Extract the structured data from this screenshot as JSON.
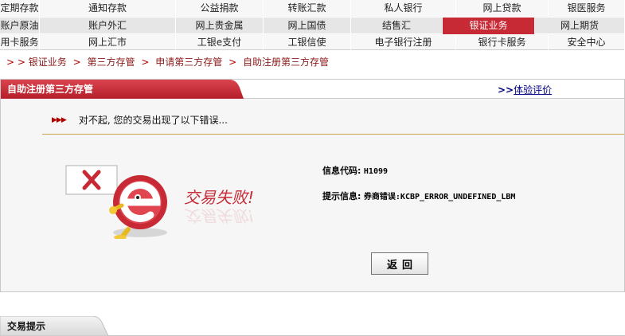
{
  "nav": {
    "rows": [
      [
        "定期存款",
        "通知存款",
        "公益捐款",
        "转账汇款",
        "私人银行",
        "网上贷款",
        "银医服务"
      ],
      [
        "账户原油",
        "账户外汇",
        "网上贵金属",
        "网上国债",
        "结售汇",
        "银证业务",
        "网上期货"
      ],
      [
        "用卡服务",
        "网上汇市",
        "工银e支付",
        "工银信使",
        "电子银行注册",
        "银行卡服务",
        "安全中心"
      ]
    ],
    "active_label": "银证业务"
  },
  "breadcrumb": {
    "prefix": "> >",
    "items": [
      "银证业务",
      "第三方存管",
      "申请第三方存管",
      "自助注册第三方存管"
    ],
    "separator": ">"
  },
  "panel": {
    "title": "自助注册第三方存管",
    "feedback_arrow": ">>",
    "feedback_link": "体验评价",
    "message_marker": "▶▶▶",
    "message": "对不起, 您的交易出现了以下错误...",
    "fail_text": "交易失败!",
    "info_code_label": "信息代码:",
    "info_code_value": "H1099",
    "info_tip_label": "提示信息:",
    "info_tip_value": "券商错误:KCBP_ERROR_UNDEFINED_LBM",
    "back_button": "返回"
  },
  "bottom": {
    "title": "交易提示"
  },
  "colors": {
    "brand_red": "#c72a35",
    "link_blue": "#000080",
    "divider_gold": "#c9a24a"
  },
  "icons": {
    "error": "red-x-card-icon",
    "mascot": "e-mascot-icon",
    "marker": "red-triangle-bullets-icon"
  }
}
